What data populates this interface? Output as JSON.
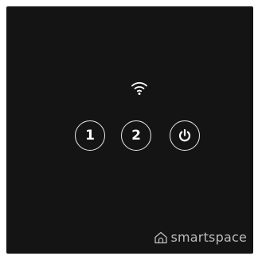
{
  "panel": {
    "background": "#141414",
    "accent": "#e9e9e9"
  },
  "status": {
    "wifi_icon": "wifi-icon"
  },
  "buttons": [
    {
      "label": "1",
      "icon": "number-one"
    },
    {
      "label": "2",
      "icon": "number-two"
    },
    {
      "label": "",
      "icon": "power-icon"
    }
  ],
  "brand": {
    "name": "smartspace",
    "icon": "house-icon"
  }
}
